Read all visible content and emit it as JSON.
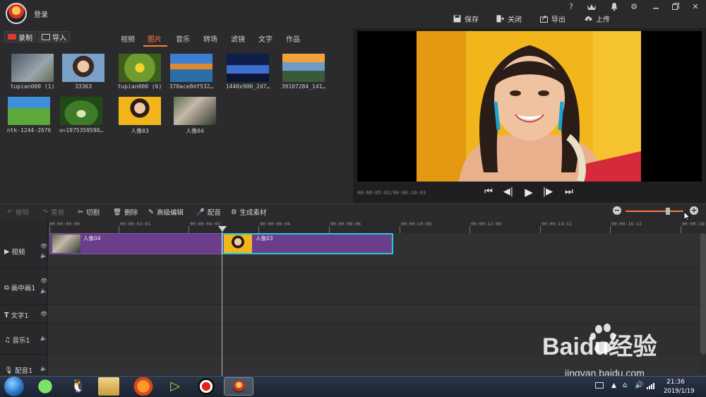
{
  "topbar": {
    "login_label": "登录",
    "window_controls": [
      "?",
      "VIP",
      "bell",
      "gear",
      "minimize",
      "restore",
      "close"
    ],
    "actions": [
      {
        "label": "保存",
        "icon": "save-icon"
      },
      {
        "label": "关闭",
        "icon": "exit-icon"
      },
      {
        "label": "导出",
        "icon": "export-icon"
      },
      {
        "label": "上传",
        "icon": "upload-icon"
      }
    ]
  },
  "library": {
    "record_label": "录制",
    "import_label": "导入",
    "tabs": [
      "视频",
      "图片",
      "音乐",
      "转场",
      "滤镜",
      "文字",
      "作品"
    ],
    "active_tab": "图片",
    "items": [
      {
        "label": "tupian000 (1)"
      },
      {
        "label": "33363"
      },
      {
        "label": "tupian000 (6)"
      },
      {
        "label": "370ace8df532…"
      },
      {
        "label": "1440x900_2d7…"
      },
      {
        "label": "39107284_141…"
      },
      {
        "label": "ntk-1244-2676"
      },
      {
        "label": "u=1975359590…"
      },
      {
        "label": "人像03"
      },
      {
        "label": "人像04"
      }
    ]
  },
  "preview": {
    "timecode": "00:00:05:02/00:00:10:03",
    "controls": [
      "skip-back",
      "prev-frame",
      "play",
      "next-frame",
      "skip-forward"
    ]
  },
  "edit_toolbar": {
    "undo": "撤销",
    "redo": "重做",
    "cut": "切割",
    "delete": "删除",
    "advanced": "高级编辑",
    "dub": "配音",
    "generate": "生成素材",
    "zoom_level": 0.75
  },
  "timeline": {
    "ruler": [
      "00:00:00:00",
      "00:00:02:01",
      "00:00:04:03",
      "00:00:06:04",
      "00:00:08:06",
      "00:00:10:08",
      "00:00:12:09",
      "00:00:14:11",
      "00:00:16:12",
      "00:00:18:"
    ],
    "tracks": [
      "视频",
      "画中画1",
      "文字1",
      "音乐1",
      "配音1"
    ],
    "clips": [
      {
        "label": "人像04"
      },
      {
        "label": "人像03"
      }
    ]
  },
  "taskbar": {
    "time": "21:36",
    "date": "2019/1/19"
  },
  "watermark": {
    "brand": "Baidu经验",
    "url": "jingyan.baidu.com"
  },
  "colors": {
    "accent": "#ff7a3d",
    "clip": "#6b3e8c",
    "selected_clip_border": "#29c7d8",
    "background": "#2b2b2e"
  }
}
